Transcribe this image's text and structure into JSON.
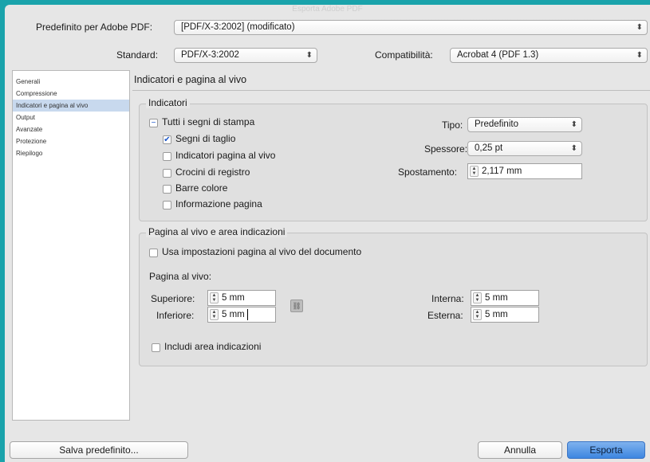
{
  "window": {
    "title": "Esporta Adobe PDF"
  },
  "preset": {
    "label": "Predefinito per Adobe PDF:",
    "value": "[PDF/X-3:2002] (modificato)"
  },
  "standard": {
    "label": "Standard:",
    "value": "PDF/X-3:2002"
  },
  "compatibility": {
    "label": "Compatibilità:",
    "value": "Acrobat 4 (PDF 1.3)"
  },
  "sidebar": {
    "items": [
      {
        "label": "Generali"
      },
      {
        "label": "Compressione"
      },
      {
        "label": "Indicatori e pagina al vivo"
      },
      {
        "label": "Output"
      },
      {
        "label": "Avanzate"
      },
      {
        "label": "Protezione"
      },
      {
        "label": "Riepilogo"
      }
    ]
  },
  "section_title": "Indicatori e pagina al vivo",
  "marks": {
    "group_title": "Indicatori",
    "all_marks": "Tutti i segni di stampa",
    "crop_marks": "Segni di taglio",
    "bleed_marks": "Indicatori pagina al vivo",
    "registration_marks": "Crocini di registro",
    "color_bars": "Barre colore",
    "page_info": "Informazione pagina",
    "type_label": "Tipo:",
    "type_value": "Predefinito",
    "weight_label": "Spessore:",
    "weight_value": "0,25 pt",
    "offset_label": "Spostamento:",
    "offset_value": "2,117 mm"
  },
  "bleed": {
    "group_title": "Pagina al vivo e area indicazioni",
    "use_document": "Usa impostazioni pagina al vivo del documento",
    "subtitle": "Pagina al vivo:",
    "top_label": "Superiore:",
    "top_value": "5 mm",
    "bottom_label": "Inferiore:",
    "bottom_value": "5 mm",
    "inside_label": "Interna:",
    "inside_value": "5 mm",
    "outside_label": "Esterna:",
    "outside_value": "5 mm",
    "include_slug": "Includi area indicazioni"
  },
  "buttons": {
    "save_preset": "Salva predefinito...",
    "cancel": "Annulla",
    "export": "Esporta"
  },
  "colors": {
    "background": "#1aa3ab",
    "dialog": "#e6e6e6",
    "default_button": "#3d86e0",
    "check": "#1b56c9"
  }
}
